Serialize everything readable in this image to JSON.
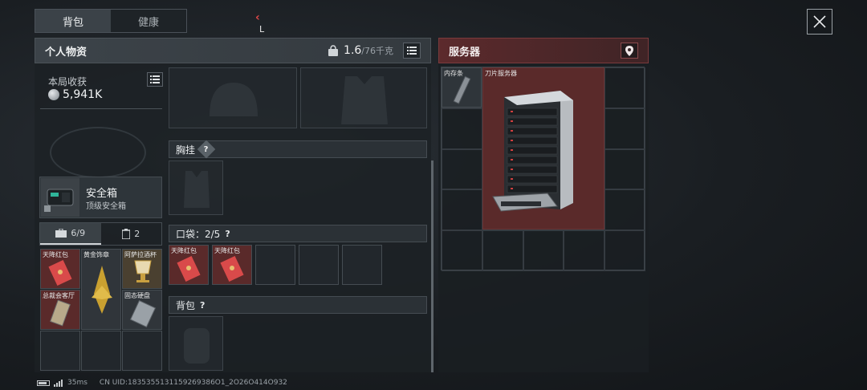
{
  "top_tabs": [
    {
      "label": "背包"
    },
    {
      "label": "健康"
    }
  ],
  "personal": {
    "title": "个人物资",
    "weight_current": "1.6",
    "weight_max": "/76千克"
  },
  "earnings": {
    "label": "本局收获",
    "value": "5,941K"
  },
  "safe_box": {
    "name": "安全箱",
    "subtitle": "顶级安全箱"
  },
  "inventory_tabs": {
    "backpack_count": "6/9",
    "other_count": "2"
  },
  "left_items": [
    {
      "label": "天降红包"
    },
    {
      "label": "黄金饰章"
    },
    {
      "label": "阿萨拉酒杯"
    },
    {
      "label": "总裁会客厅"
    },
    {
      "label": "固态硬盘"
    }
  ],
  "sections": {
    "chest_rig": "胸挂",
    "pockets": "口袋：2/5",
    "backpack": "背包"
  },
  "pocket_items": [
    {
      "label": "天降红包"
    },
    {
      "label": "天降红包"
    }
  ],
  "server": {
    "title": "服务器",
    "items": [
      {
        "label": "内存条"
      },
      {
        "label": "刀片服务器"
      }
    ]
  },
  "status": {
    "ping": "35ms",
    "uid": "CN UID:1835355131159269386O1_2O26O414O932"
  },
  "colors": {
    "accent_red": "#6b2f31",
    "rarity_red": "#5a2a2a",
    "rarity_gold": "#4a4030"
  }
}
